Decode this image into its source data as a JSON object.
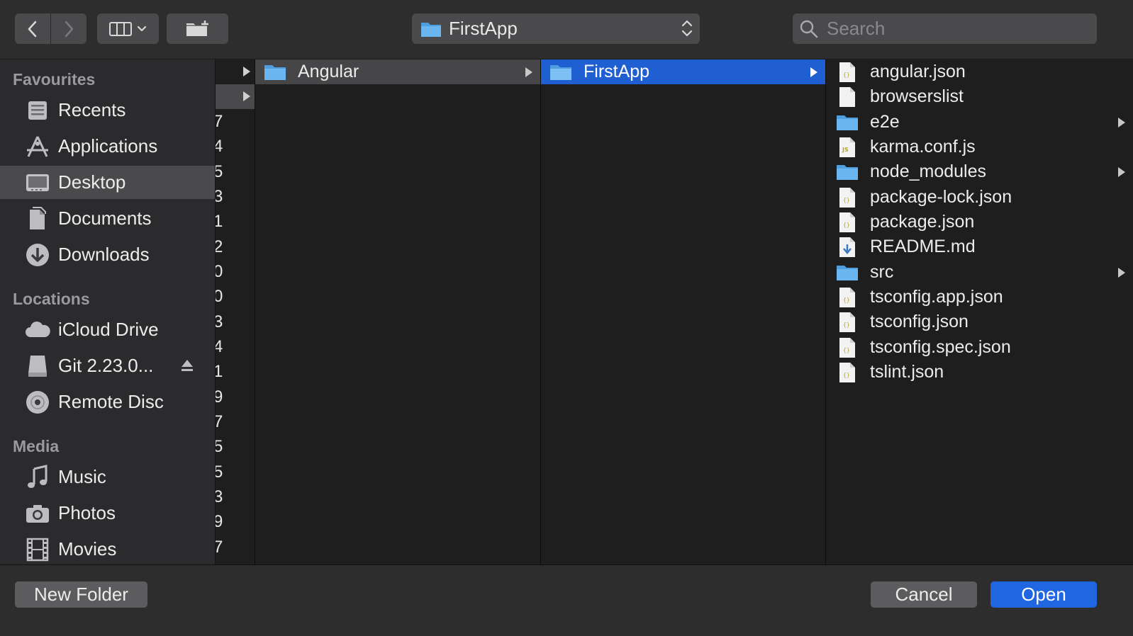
{
  "toolbar": {
    "back_icon": "chevron-left-icon",
    "forward_icon": "chevron-right-icon",
    "view_icon": "column-view-icon",
    "new_folder_icon": "folder-plus-icon",
    "path_label": "FirstApp",
    "search_placeholder": "Search"
  },
  "sidebar": {
    "sections": [
      {
        "title": "Favourites"
      },
      {
        "title": "Locations"
      },
      {
        "title": "Media"
      }
    ],
    "favourites": [
      {
        "label": "Recents",
        "icon": "recents-icon"
      },
      {
        "label": "Applications",
        "icon": "applications-icon"
      },
      {
        "label": "Desktop",
        "icon": "desktop-icon",
        "selected": true
      },
      {
        "label": "Documents",
        "icon": "documents-icon"
      },
      {
        "label": "Downloads",
        "icon": "downloads-icon"
      }
    ],
    "locations": [
      {
        "label": "iCloud Drive",
        "icon": "cloud-icon"
      },
      {
        "label": "Git 2.23.0...",
        "icon": "disk-icon",
        "eject": true
      },
      {
        "label": "Remote Disc",
        "icon": "disc-icon"
      }
    ],
    "media": [
      {
        "label": "Music",
        "icon": "music-icon"
      },
      {
        "label": "Photos",
        "icon": "camera-icon"
      },
      {
        "label": "Movies",
        "icon": "film-icon"
      }
    ]
  },
  "columns": {
    "col0_partial_digits": [
      "7",
      "4",
      "5",
      "3",
      "1",
      "2",
      "0",
      "0",
      "3",
      "4",
      "1",
      "9",
      "7",
      "5",
      "5",
      "3",
      "9",
      "7"
    ],
    "col1": [
      {
        "name": "Angular",
        "type": "folder",
        "selected": "inactive"
      }
    ],
    "col2": [
      {
        "name": "FirstApp",
        "type": "folder",
        "selected": "active"
      }
    ],
    "col3": [
      {
        "name": "angular.json",
        "type": "json"
      },
      {
        "name": "browserslist",
        "type": "file"
      },
      {
        "name": "e2e",
        "type": "folder"
      },
      {
        "name": "karma.conf.js",
        "type": "js"
      },
      {
        "name": "node_modules",
        "type": "folder"
      },
      {
        "name": "package-lock.json",
        "type": "json"
      },
      {
        "name": "package.json",
        "type": "json"
      },
      {
        "name": "README.md",
        "type": "md"
      },
      {
        "name": "src",
        "type": "folder"
      },
      {
        "name": "tsconfig.app.json",
        "type": "json"
      },
      {
        "name": "tsconfig.json",
        "type": "json"
      },
      {
        "name": "tsconfig.spec.json",
        "type": "json"
      },
      {
        "name": "tslint.json",
        "type": "json"
      }
    ]
  },
  "footer": {
    "new_folder_label": "New Folder",
    "cancel_label": "Cancel",
    "open_label": "Open"
  },
  "colors": {
    "accent": "#1f66e0",
    "selection": "#1f5fd1",
    "folder": "#5aa9e6"
  }
}
